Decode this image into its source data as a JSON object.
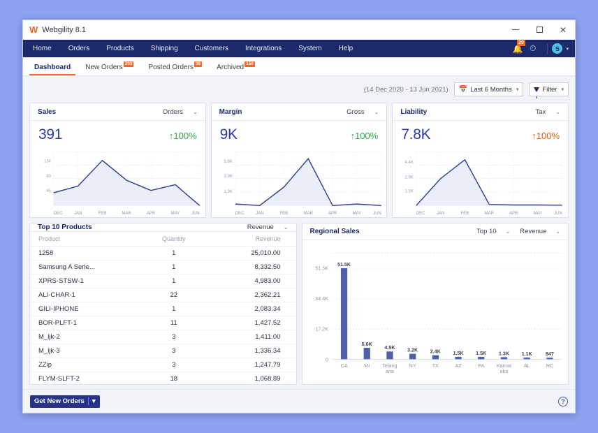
{
  "window": {
    "title": "Webgility 8.1",
    "logo": "webgility-w-logo",
    "controls": {
      "minimize": "minimize-icon",
      "maximize": "maximize-icon",
      "close": "close-icon"
    }
  },
  "nav": {
    "items": [
      {
        "label": "Home"
      },
      {
        "label": "Orders"
      },
      {
        "label": "Products"
      },
      {
        "label": "Shipping"
      },
      {
        "label": "Customers"
      },
      {
        "label": "Integrations"
      },
      {
        "label": "System"
      },
      {
        "label": "Help"
      }
    ],
    "notifications": {
      "icon": "bell-icon",
      "count": "20"
    },
    "timer": {
      "icon": "timer-icon"
    },
    "user": {
      "initial": "S",
      "caret": "▾"
    }
  },
  "tabs": [
    {
      "label": "Dashboard",
      "badge": "",
      "active": true
    },
    {
      "label": "New Orders",
      "badge": "203",
      "active": false
    },
    {
      "label": "Posted Orders",
      "badge": "38",
      "active": false
    },
    {
      "label": "Archived",
      "badge": "150",
      "active": false
    }
  ],
  "toolbar": {
    "date_range_text": "(14 Dec 2020 - 13 Jun 2021)",
    "period_label": "Last 6 Months",
    "filter_label": "Filter",
    "caret": "▾"
  },
  "kpi_cards": [
    {
      "title": "Sales",
      "metric": "Orders",
      "value": "391",
      "delta": "100%",
      "delta_arrow": "↑",
      "delta_dir": "up"
    },
    {
      "title": "Margin",
      "metric": "Gross",
      "value": "9K",
      "delta": "100%",
      "delta_arrow": "↑",
      "delta_dir": "up"
    },
    {
      "title": "Liability",
      "metric": "Tax",
      "value": "7.8K",
      "delta": "100%",
      "delta_arrow": "↑",
      "delta_dir": "down"
    }
  ],
  "products_panel": {
    "title": "Top 10 Products",
    "sort_label": "Revenue",
    "caret": "▾",
    "columns": [
      "Product",
      "Quantity",
      "Revenue"
    ],
    "rows": [
      {
        "product": "1258",
        "quantity": "1",
        "revenue": "25,010.00"
      },
      {
        "product": "Samsung A Serie...",
        "quantity": "1",
        "revenue": "8,332.50"
      },
      {
        "product": "XPRS-STSW-1",
        "quantity": "1",
        "revenue": "4,983.00"
      },
      {
        "product": "ALI-CHAR-1",
        "quantity": "22",
        "revenue": "2,362.21"
      },
      {
        "product": "GILI-IPHONE",
        "quantity": "1",
        "revenue": "2,083.34"
      },
      {
        "product": "BOR-PLFT-1",
        "quantity": "11",
        "revenue": "1,427.52"
      },
      {
        "product": "M_ljk-2",
        "quantity": "3",
        "revenue": "1,411.00"
      },
      {
        "product": "M_ljk-3",
        "quantity": "3",
        "revenue": "1,336.34"
      },
      {
        "product": "ZZip",
        "quantity": "3",
        "revenue": "1,247.79"
      },
      {
        "product": "FLYM-SLFT-2",
        "quantity": "18",
        "revenue": "1,068.89"
      }
    ]
  },
  "regional_panel": {
    "title": "Regional Sales",
    "top_label": "Top 10",
    "metric_label": "Revenue",
    "caret": "▾"
  },
  "footer": {
    "get_orders_label": "Get New Orders",
    "get_orders_caret": "▾",
    "help_icon": "help-icon",
    "help_glyph": "?"
  },
  "colors": {
    "nav_bg": "#1c2a6b",
    "accent_orange": "#f26522",
    "kpi_value_blue": "#2b3da0",
    "delta_up_green": "#29a745",
    "delta_down_orange": "#e8590c",
    "chart_line": "#2f3f8f",
    "chart_fill": "#e6ebf7",
    "bar_fill": "#4f5fa8",
    "desktop_bg": "#8da2ee"
  },
  "chart_data": [
    {
      "type": "area",
      "title": "Sales",
      "categories": [
        "DEC",
        "JAN",
        "FEB",
        "MAR",
        "APR",
        "MAY",
        "JUN"
      ],
      "values": [
        38,
        58,
        134,
        75,
        45,
        62,
        0
      ],
      "ytick_labels": [
        "134",
        "89",
        "45"
      ],
      "ytick_values": [
        134,
        89,
        45
      ],
      "ylim": [
        0,
        160
      ],
      "xlabel": "",
      "ylabel": "Orders",
      "grid": true,
      "legend": "none"
    },
    {
      "type": "area",
      "title": "Margin",
      "categories": [
        "DEC",
        "JAN",
        "FEB",
        "MAR",
        "APR",
        "MAY",
        "JUN"
      ],
      "values": [
        200,
        0,
        2400,
        6100,
        0,
        200,
        0
      ],
      "ytick_labels": [
        "5.8K",
        "3.9K",
        "1.9K"
      ],
      "ytick_values": [
        5800,
        3900,
        1900
      ],
      "ylim": [
        0,
        7000
      ],
      "xlabel": "",
      "ylabel": "Gross",
      "grid": true,
      "legend": "none"
    },
    {
      "type": "area",
      "title": "Liability",
      "categories": [
        "DEC",
        "JAN",
        "FEB",
        "MAR",
        "APR",
        "MAY",
        "JUN"
      ],
      "values": [
        0,
        2700,
        4600,
        120,
        60,
        60,
        40
      ],
      "ytick_labels": [
        "4.4K",
        "2.9K",
        "1.5K"
      ],
      "ytick_values": [
        4400,
        2900,
        1500
      ],
      "ylim": [
        0,
        5400
      ],
      "xlabel": "",
      "ylabel": "Tax",
      "grid": true,
      "legend": "none"
    },
    {
      "type": "bar",
      "title": "Regional Sales",
      "categories": [
        "CA",
        "MI",
        "Telang ana",
        "NY",
        "TX",
        "AZ",
        "PA",
        "Karnat aka",
        "AL",
        "NC"
      ],
      "values": [
        51500,
        6600,
        4500,
        3200,
        2400,
        1500,
        1500,
        1300,
        1100,
        847
      ],
      "data_labels": [
        "51.5K",
        "6.6K",
        "4.5K",
        "3.2K",
        "2.4K",
        "1.5K",
        "1.5K",
        "1.3K",
        "1.1K",
        "847"
      ],
      "ytick_labels": [
        "51.5K",
        "34.4K",
        "17.2K",
        "0"
      ],
      "ytick_values": [
        51500,
        34400,
        17200,
        0
      ],
      "ylim": [
        0,
        60000
      ],
      "xlabel": "",
      "ylabel": "Revenue",
      "grid": true,
      "legend": "none"
    }
  ]
}
